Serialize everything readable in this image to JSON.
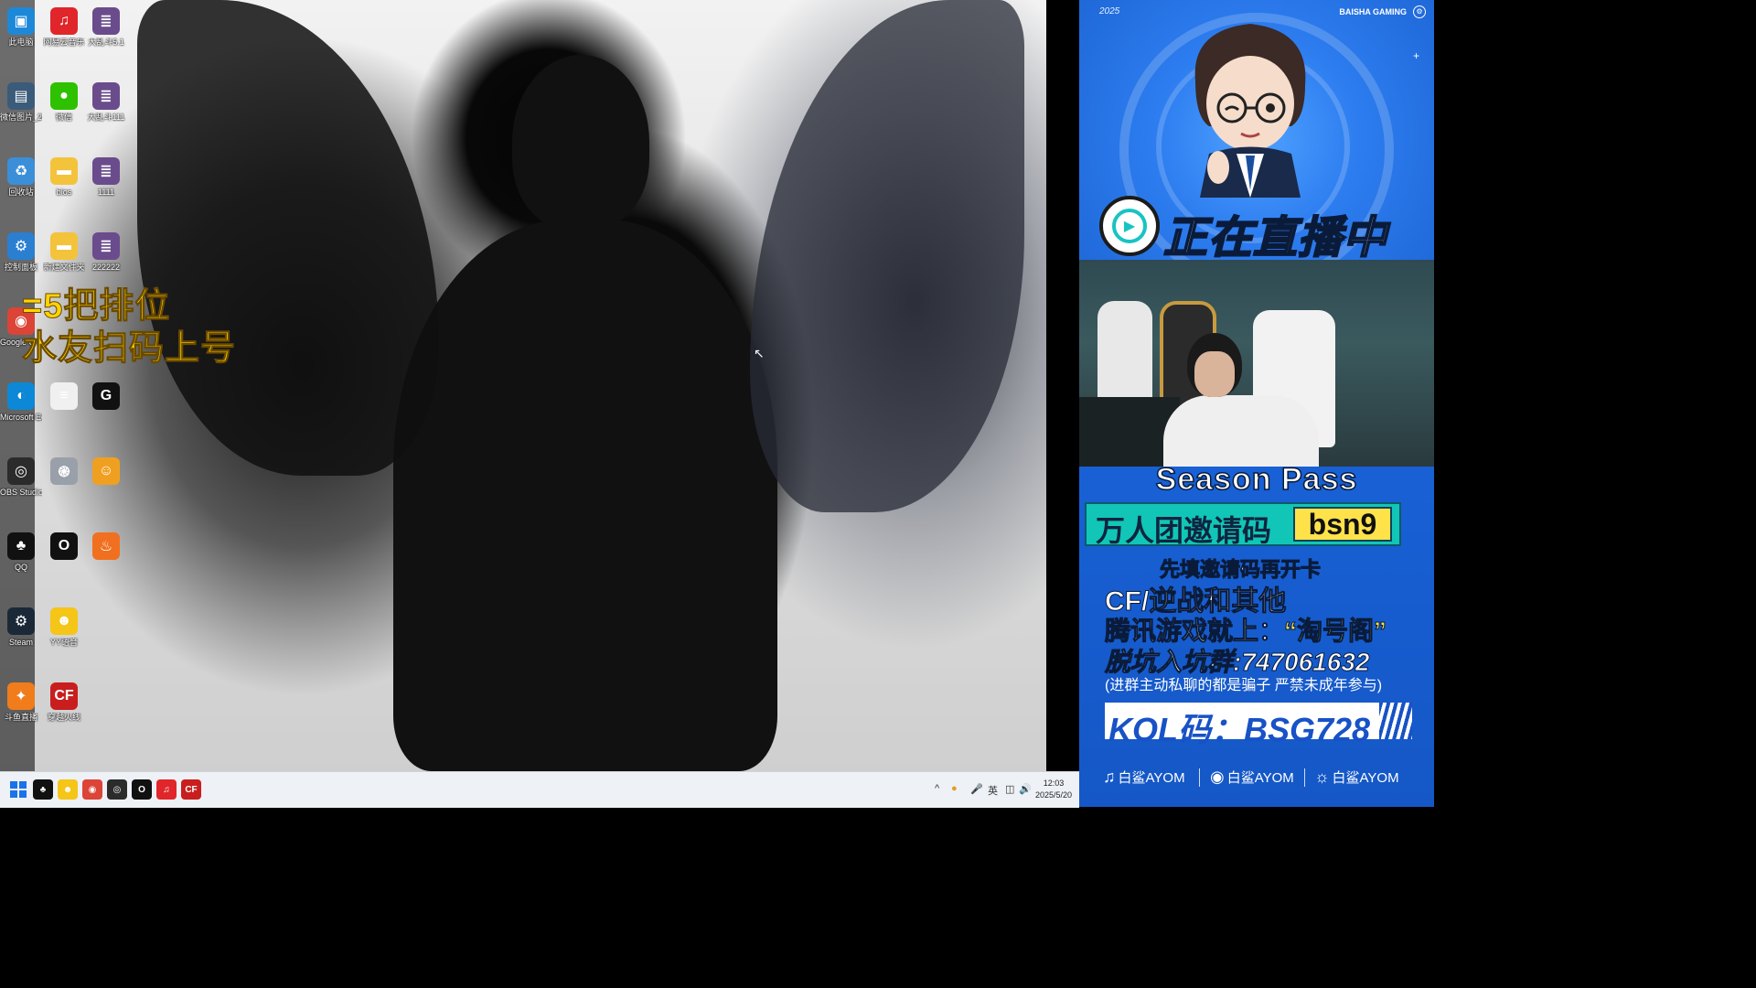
{
  "desktop": {
    "icons": [
      {
        "label": "此电脑",
        "icon": "computer-icon",
        "color": "#1e88d8"
      },
      {
        "label": "网易云音乐",
        "icon": "netease-music-icon",
        "color": "#e0262a"
      },
      {
        "label": "大乱斗5.1",
        "icon": "game-file-icon",
        "color": "#6a4c8c"
      },
      {
        "label": "微信图片_2025051...",
        "icon": "image-file-icon",
        "color": "#3b5b7a"
      },
      {
        "label": "微信",
        "icon": "wechat-icon",
        "color": "#2dc100"
      },
      {
        "label": "大乱斗111",
        "icon": "game-file-icon",
        "color": "#6a4c8c"
      },
      {
        "label": "回收站",
        "icon": "recycle-bin-icon",
        "color": "#3a8fd8"
      },
      {
        "label": "bios",
        "icon": "folder-icon",
        "color": "#f3c33b"
      },
      {
        "label": "1111",
        "icon": "game-file-icon",
        "color": "#6a4c8c"
      },
      {
        "label": "控制面板",
        "icon": "control-panel-icon",
        "color": "#2a7fd0"
      },
      {
        "label": "新建文件夹",
        "icon": "folder-icon",
        "color": "#f3c33b"
      },
      {
        "label": "222222",
        "icon": "game-file-icon",
        "color": "#6a4c8c"
      },
      {
        "label": "Google Chrome",
        "icon": "chrome-icon",
        "color": "#db4437"
      },
      {
        "label": "Microsoft Edge",
        "icon": "edge-icon",
        "color": "#0c88d6"
      },
      {
        "label": "",
        "icon": "text-file-icon",
        "color": "#f0f0f0"
      },
      {
        "label": "",
        "icon": "logitech-g-icon",
        "color": "#111111"
      },
      {
        "label": "OBS Studio",
        "icon": "obs-icon",
        "color": "#2b2b2b"
      },
      {
        "label": "",
        "icon": "app-swirl-icon",
        "color": "#9aa0aa"
      },
      {
        "label": "",
        "icon": "game-mascot-icon",
        "color": "#f0a020"
      },
      {
        "label": "QQ",
        "icon": "qq-icon",
        "color": "#111111"
      },
      {
        "label": "",
        "icon": "app-o-icon",
        "color": "#111111"
      },
      {
        "label": "",
        "icon": "app-flame-icon",
        "color": "#f07020"
      },
      {
        "label": "Steam",
        "icon": "steam-icon",
        "color": "#1b2838"
      },
      {
        "label": "YY语音",
        "icon": "yy-voice-icon",
        "color": "#f5c518"
      },
      {
        "label": "斗鱼直播",
        "icon": "douyu-icon",
        "color": "#f07c1c"
      },
      {
        "label": "穿越火线",
        "icon": "crossfire-icon",
        "color": "#c81e1e"
      }
    ],
    "overlay_text": [
      "=5把排位",
      "水友扫码上号"
    ]
  },
  "taskbar": {
    "start_icon": "windows-start-icon",
    "pinned": [
      {
        "icon": "qq-icon",
        "color": "#111111"
      },
      {
        "icon": "yy-voice-icon",
        "color": "#f5c518"
      },
      {
        "icon": "chrome-icon",
        "color": "#db4437"
      },
      {
        "icon": "obs-icon",
        "color": "#2b2b2b"
      },
      {
        "icon": "app-o-icon",
        "color": "#111111"
      },
      {
        "icon": "netease-music-icon",
        "color": "#e0262a"
      },
      {
        "icon": "crossfire-icon",
        "color": "#c81e1e"
      }
    ],
    "tray": {
      "chevron": "^",
      "ime_label": "英"
    },
    "clock": {
      "time": "12:03",
      "date": "2025/5/20"
    }
  },
  "stream_panel": {
    "year": "2025",
    "brand": "BAISHA GAMING",
    "live_banner": "正在直播中",
    "season_title": "Season Pass",
    "invite_label": "万人团邀请码",
    "invite_code": "bsn9",
    "line1": "先填邀请码再开卡",
    "line2": "CF/逆战和其他",
    "line3_prefix": "腾讯游戏就上：",
    "line3_highlight": "“淘号阁”",
    "line4": "脱坑入坑群:747061632",
    "note": "(进群主动私聊的都是骗子 严禁未成年参与)",
    "kol": "KOL码：BSG728",
    "socials": [
      {
        "icon": "douyin-icon",
        "label": "白鲨AYOM"
      },
      {
        "icon": "kuaishou-icon",
        "label": "白鲨AYOM"
      },
      {
        "icon": "weibo-icon",
        "label": "白鲨AYOM"
      }
    ]
  }
}
